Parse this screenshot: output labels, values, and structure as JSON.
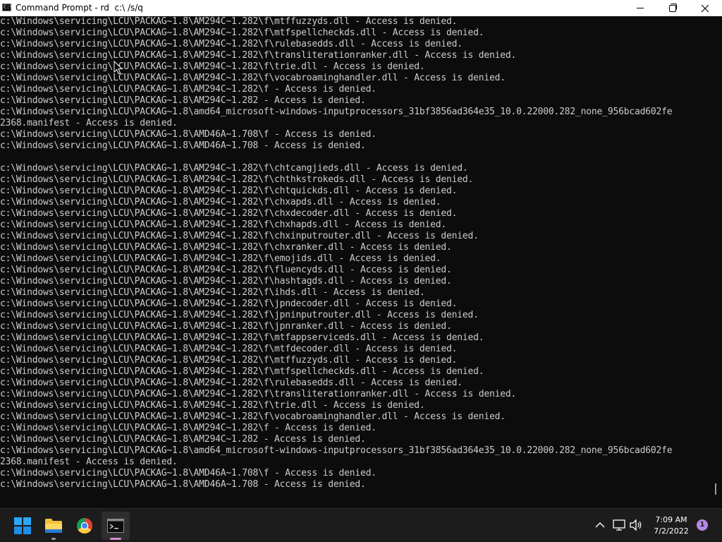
{
  "window": {
    "title": "Command Prompt - rd  c:\\ /s/q",
    "app_icon_text": "C:\\"
  },
  "console": {
    "lines": [
      "c:\\Windows\\servicing\\LCU\\PACKAG~1.8\\AM294C~1.282\\f\\mtffuzzyds.dll - Access is denied.",
      "c:\\Windows\\servicing\\LCU\\PACKAG~1.8\\AM294C~1.282\\f\\mtfspellcheckds.dll - Access is denied.",
      "c:\\Windows\\servicing\\LCU\\PACKAG~1.8\\AM294C~1.282\\f\\rulebasedds.dll - Access is denied.",
      "c:\\Windows\\servicing\\LCU\\PACKAG~1.8\\AM294C~1.282\\f\\transliterationranker.dll - Access is denied.",
      "c:\\Windows\\servicing\\LCU\\PACKAG~1.8\\AM294C~1.282\\f\\trie.dll - Access is denied.",
      "c:\\Windows\\servicing\\LCU\\PACKAG~1.8\\AM294C~1.282\\f\\vocabroaminghandler.dll - Access is denied.",
      "c:\\Windows\\servicing\\LCU\\PACKAG~1.8\\AM294C~1.282\\f - Access is denied.",
      "c:\\Windows\\servicing\\LCU\\PACKAG~1.8\\AM294C~1.282 - Access is denied.",
      "c:\\Windows\\servicing\\LCU\\PACKAG~1.8\\amd64_microsoft-windows-inputprocessors_31bf3856ad364e35_10.0.22000.282_none_956bcad602fe",
      "2368.manifest - Access is denied.",
      "c:\\Windows\\servicing\\LCU\\PACKAG~1.8\\AMD46A~1.708\\f - Access is denied.",
      "c:\\Windows\\servicing\\LCU\\PACKAG~1.8\\AMD46A~1.708 - Access is denied.",
      "",
      "c:\\Windows\\servicing\\LCU\\PACKAG~1.8\\AM294C~1.282\\f\\chtcangjieds.dll - Access is denied.",
      "c:\\Windows\\servicing\\LCU\\PACKAG~1.8\\AM294C~1.282\\f\\chthkstrokeds.dll - Access is denied.",
      "c:\\Windows\\servicing\\LCU\\PACKAG~1.8\\AM294C~1.282\\f\\chtquickds.dll - Access is denied.",
      "c:\\Windows\\servicing\\LCU\\PACKAG~1.8\\AM294C~1.282\\f\\chxapds.dll - Access is denied.",
      "c:\\Windows\\servicing\\LCU\\PACKAG~1.8\\AM294C~1.282\\f\\chxdecoder.dll - Access is denied.",
      "c:\\Windows\\servicing\\LCU\\PACKAG~1.8\\AM294C~1.282\\f\\chxhapds.dll - Access is denied.",
      "c:\\Windows\\servicing\\LCU\\PACKAG~1.8\\AM294C~1.282\\f\\chxinputrouter.dll - Access is denied.",
      "c:\\Windows\\servicing\\LCU\\PACKAG~1.8\\AM294C~1.282\\f\\chxranker.dll - Access is denied.",
      "c:\\Windows\\servicing\\LCU\\PACKAG~1.8\\AM294C~1.282\\f\\emojids.dll - Access is denied.",
      "c:\\Windows\\servicing\\LCU\\PACKAG~1.8\\AM294C~1.282\\f\\fluencyds.dll - Access is denied.",
      "c:\\Windows\\servicing\\LCU\\PACKAG~1.8\\AM294C~1.282\\f\\hashtagds.dll - Access is denied.",
      "c:\\Windows\\servicing\\LCU\\PACKAG~1.8\\AM294C~1.282\\f\\ihds.dll - Access is denied.",
      "c:\\Windows\\servicing\\LCU\\PACKAG~1.8\\AM294C~1.282\\f\\jpndecoder.dll - Access is denied.",
      "c:\\Windows\\servicing\\LCU\\PACKAG~1.8\\AM294C~1.282\\f\\jpninputrouter.dll - Access is denied.",
      "c:\\Windows\\servicing\\LCU\\PACKAG~1.8\\AM294C~1.282\\f\\jpnranker.dll - Access is denied.",
      "c:\\Windows\\servicing\\LCU\\PACKAG~1.8\\AM294C~1.282\\f\\mtfappserviceds.dll - Access is denied.",
      "c:\\Windows\\servicing\\LCU\\PACKAG~1.8\\AM294C~1.282\\f\\mtfdecoder.dll - Access is denied.",
      "c:\\Windows\\servicing\\LCU\\PACKAG~1.8\\AM294C~1.282\\f\\mtffuzzyds.dll - Access is denied.",
      "c:\\Windows\\servicing\\LCU\\PACKAG~1.8\\AM294C~1.282\\f\\mtfspellcheckds.dll - Access is denied.",
      "c:\\Windows\\servicing\\LCU\\PACKAG~1.8\\AM294C~1.282\\f\\rulebasedds.dll - Access is denied.",
      "c:\\Windows\\servicing\\LCU\\PACKAG~1.8\\AM294C~1.282\\f\\transliterationranker.dll - Access is denied.",
      "c:\\Windows\\servicing\\LCU\\PACKAG~1.8\\AM294C~1.282\\f\\trie.dll - Access is denied.",
      "c:\\Windows\\servicing\\LCU\\PACKAG~1.8\\AM294C~1.282\\f\\vocabroaminghandler.dll - Access is denied.",
      "c:\\Windows\\servicing\\LCU\\PACKAG~1.8\\AM294C~1.282\\f - Access is denied.",
      "c:\\Windows\\servicing\\LCU\\PACKAG~1.8\\AM294C~1.282 - Access is denied.",
      "c:\\Windows\\servicing\\LCU\\PACKAG~1.8\\amd64_microsoft-windows-inputprocessors_31bf3856ad364e35_10.0.22000.282_none_956bcad602fe",
      "2368.manifest - Access is denied.",
      "c:\\Windows\\servicing\\LCU\\PACKAG~1.8\\AMD46A~1.708\\f - Access is denied.",
      "c:\\Windows\\servicing\\LCU\\PACKAG~1.8\\AMD46A~1.708 - Access is denied."
    ]
  },
  "taskbar": {
    "apps": [
      {
        "name": "start",
        "icon": "windows-logo-icon"
      },
      {
        "name": "file-explorer",
        "icon": "folder-icon"
      },
      {
        "name": "chrome",
        "icon": "chrome-icon"
      },
      {
        "name": "command-prompt",
        "icon": "terminal-icon"
      }
    ],
    "clock_time": "7:09 AM",
    "clock_date": "7/2/2022",
    "notification_count": "1"
  },
  "colors": {
    "console_bg": "#0c0c0c",
    "console_text": "#cccccc",
    "taskbar_bg": "#1c1c1c",
    "accent": "#d58fd4"
  }
}
